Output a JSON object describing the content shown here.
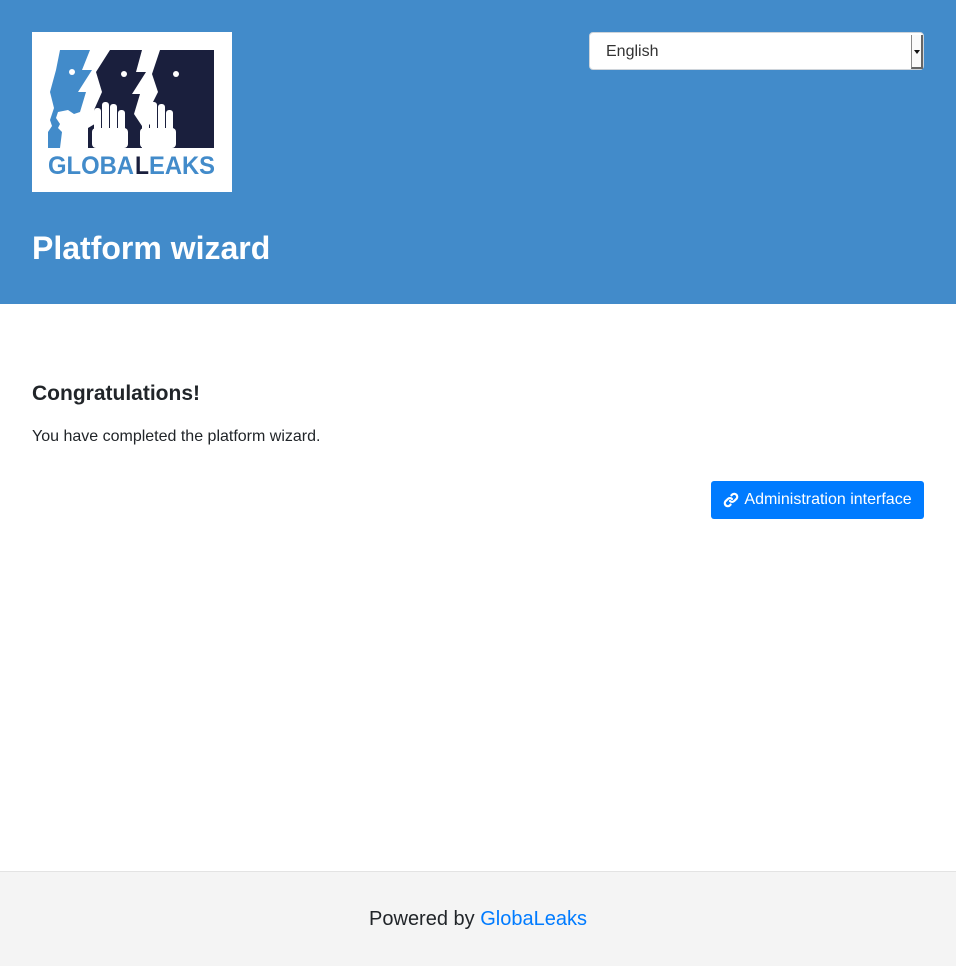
{
  "header": {
    "logo": {
      "icon": "globaleaks-logo",
      "text_left": "GLOBA",
      "text_mid": "L",
      "text_right": "EAKS"
    },
    "language_select": {
      "value": "English",
      "icon": "chevron-down-icon"
    },
    "title": "Platform wizard",
    "background_color": "#428bca"
  },
  "main": {
    "heading": "Congratulations!",
    "message": "You have completed the platform wizard.",
    "admin_button": {
      "icon": "link-icon",
      "label": "Administration interface",
      "color": "#007bff"
    }
  },
  "footer": {
    "powered_by": "Powered by",
    "link_label": "GlobaLeaks",
    "link_color": "#007bff"
  }
}
